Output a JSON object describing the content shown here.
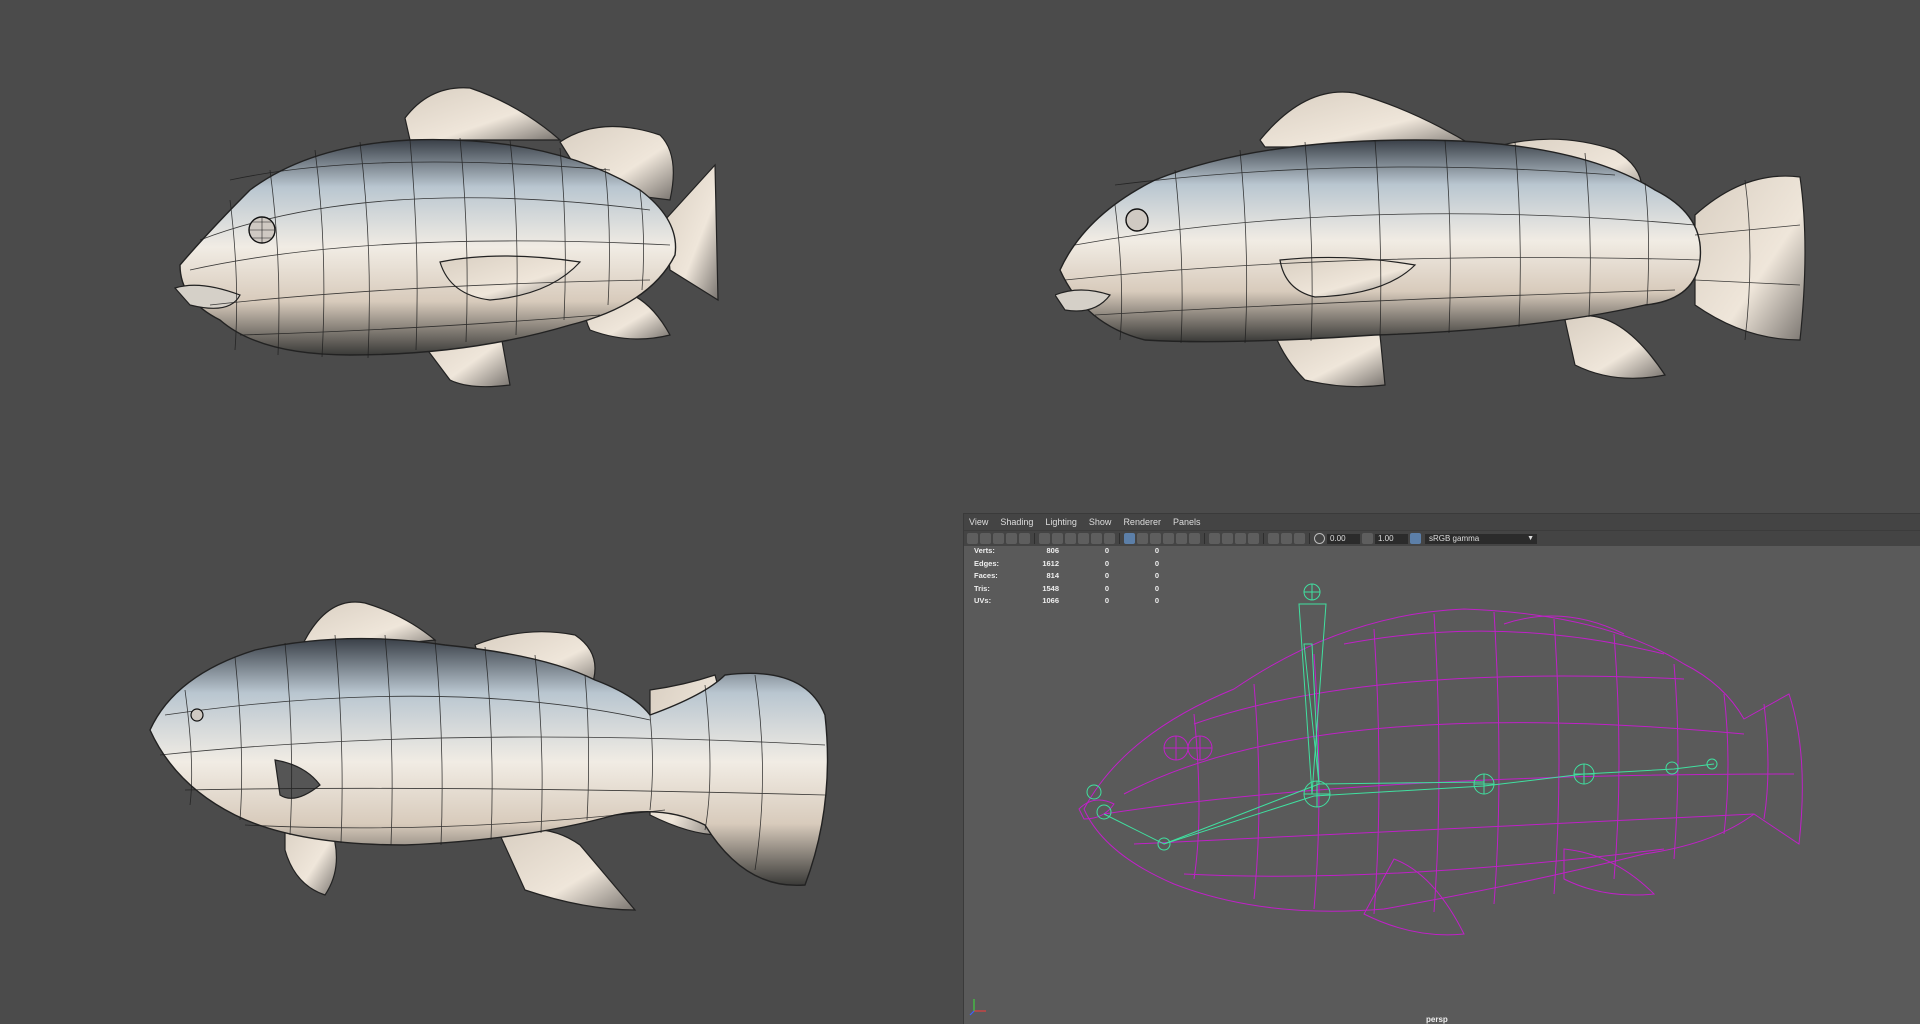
{
  "viewport": {
    "menu": [
      "View",
      "Shading",
      "Lighting",
      "Show",
      "Renderer",
      "Panels"
    ],
    "toolbar": {
      "exposure": "0.00",
      "gamma": "1.00",
      "color_space": "sRGB gamma"
    },
    "hud": [
      {
        "label": "Verts:",
        "value": "806",
        "a": "0",
        "b": "0"
      },
      {
        "label": "Edges:",
        "value": "1612",
        "a": "0",
        "b": "0"
      },
      {
        "label": "Faces:",
        "value": "814",
        "a": "0",
        "b": "0"
      },
      {
        "label": "Tris:",
        "value": "1548",
        "a": "0",
        "b": "0"
      },
      {
        "label": "UVs:",
        "value": "1066",
        "a": "0",
        "b": "0"
      }
    ],
    "camera": "persp"
  },
  "colors": {
    "background": "#4b4b4b",
    "wireframe": "#c020c8",
    "joints": "#40e0a0"
  }
}
